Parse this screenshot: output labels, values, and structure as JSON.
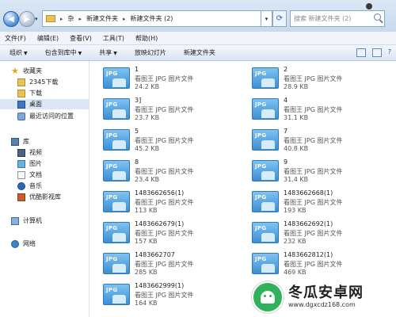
{
  "address": {
    "breadcrumbs": [
      "杂",
      "新建文件夹",
      "新建文件夹 (2)"
    ],
    "search_placeholder": "搜索 新建文件夹 (2)"
  },
  "menu": [
    "文件(F)",
    "编辑(E)",
    "查看(V)",
    "工具(T)",
    "帮助(H)"
  ],
  "toolbar": [
    "组织",
    "包含到库中",
    "共享",
    "放映幻灯片",
    "新建文件夹"
  ],
  "sidebar": {
    "favorites": "收藏夹",
    "items": [
      "2345下载",
      "下载",
      "桌面",
      "最近访问的位置"
    ],
    "library": "库",
    "library_items": [
      "视频",
      "图片",
      "文档",
      "音乐",
      "优酷影视库"
    ],
    "computer": "计算机",
    "network": "网络"
  },
  "files": [
    {
      "name": "1",
      "type": "看图王 JPG 图片文件",
      "size": "24.2 KB"
    },
    {
      "name": "2",
      "type": "看图王 JPG 图片文件",
      "size": "28.9 KB"
    },
    {
      "name": "3]",
      "type": "看图王 JPG 图片文件",
      "size": "23.7 KB"
    },
    {
      "name": "4",
      "type": "看图王 JPG 图片文件",
      "size": "31.1 KB"
    },
    {
      "name": "5",
      "type": "看图王 JPG 图片文件",
      "size": "45.2 KB"
    },
    {
      "name": "7",
      "type": "看图王 JPG 图片文件",
      "size": "40.8 KB"
    },
    {
      "name": "8",
      "type": "看图王 JPG 图片文件",
      "size": "23.4 KB"
    },
    {
      "name": "9",
      "type": "看图王 JPG 图片文件",
      "size": "31.4 KB"
    },
    {
      "name": "1483662656(1)",
      "type": "看图王 JPG 图片文件",
      "size": "113 KB"
    },
    {
      "name": "1483662668(1)",
      "type": "看图王 JPG 图片文件",
      "size": "193 KB"
    },
    {
      "name": "1483662679(1)",
      "type": "看图王 JPG 图片文件",
      "size": "157 KB"
    },
    {
      "name": "1483662692(1)",
      "type": "看图王 JPG 图片文件",
      "size": "232 KB"
    },
    {
      "name": "1483662707",
      "type": "看图王 JPG 图片文件",
      "size": "285 KB"
    },
    {
      "name": "1483662812(1)",
      "type": "看图王 JPG 图片文件",
      "size": "469 KB"
    },
    {
      "name": "1483662999(1)",
      "type": "看图王 JPG 图片文件",
      "size": "164 KB"
    }
  ],
  "icon_badge": "JPG",
  "watermark": {
    "title": "冬瓜安卓网",
    "url": "www.dgxcdz168.com"
  }
}
